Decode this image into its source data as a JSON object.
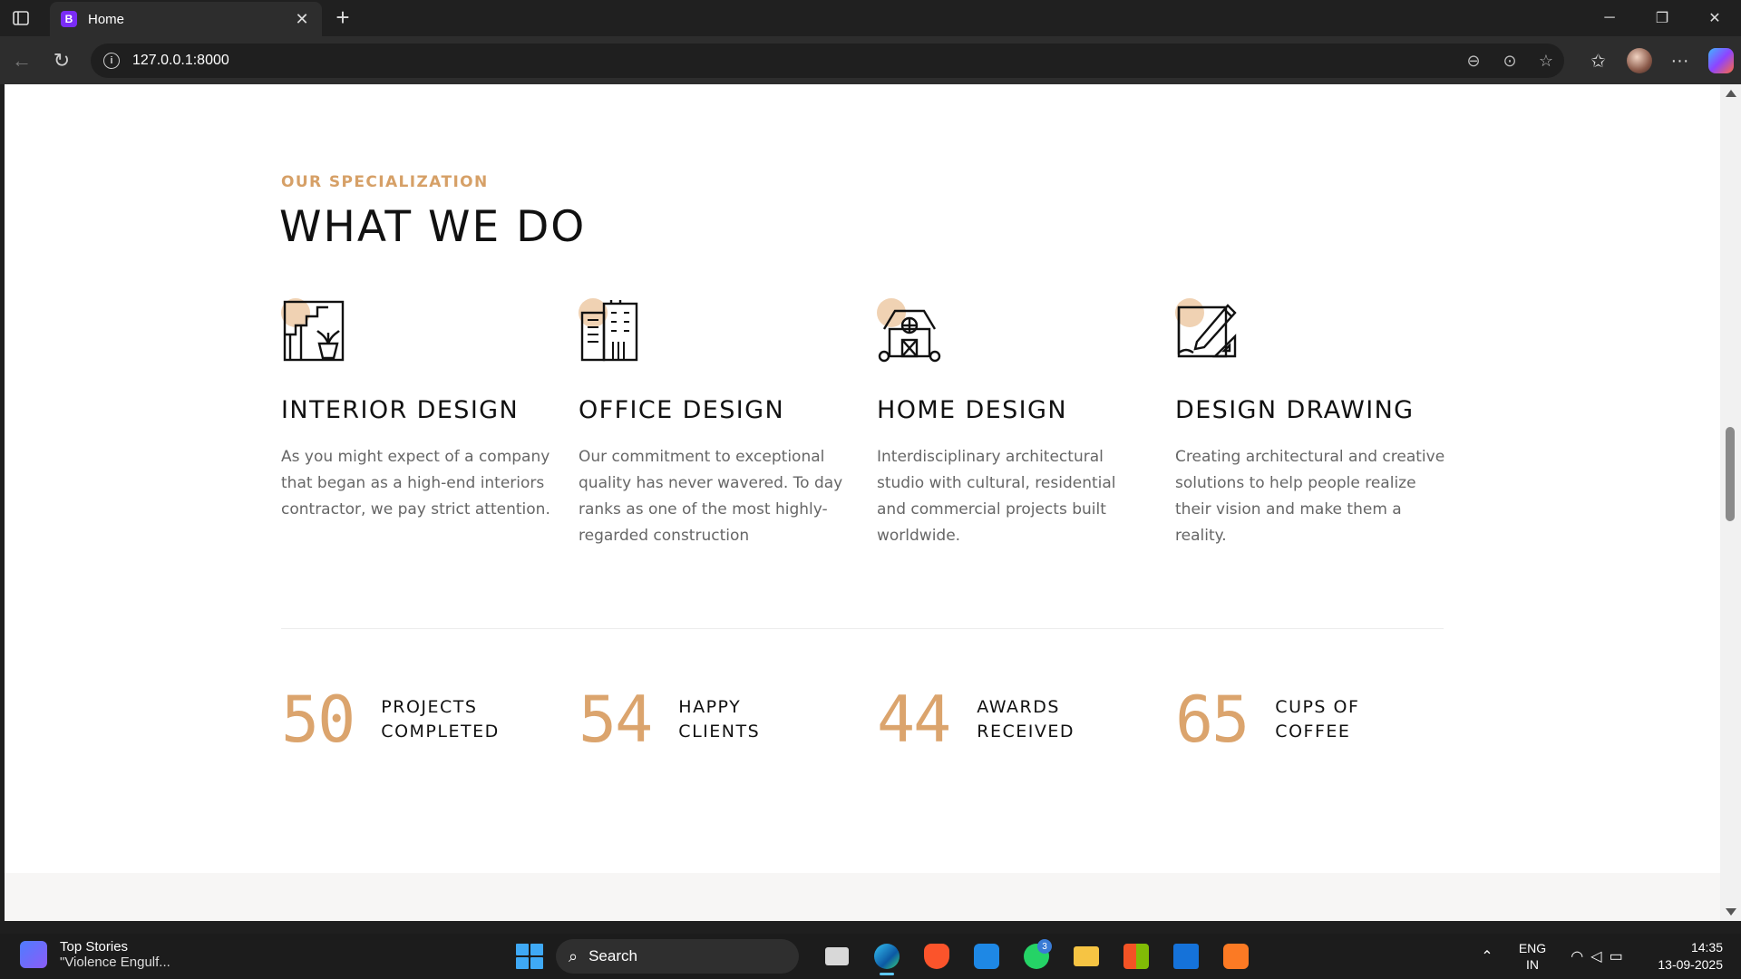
{
  "browser": {
    "tab_title": "Home",
    "tab_favicon_letter": "B",
    "url": "127.0.0.1:8000"
  },
  "page": {
    "eyebrow": "OUR SPECIALIZATION",
    "title": "WHAT WE DO",
    "accent_color": "#d6a067",
    "services": [
      {
        "icon": "staircase-plant-icon",
        "title": "INTERIOR DESIGN",
        "text": "As you might expect of a company that began as a high-end interiors contractor, we pay strict attention."
      },
      {
        "icon": "office-building-icon",
        "title": "OFFICE DESIGN",
        "text": "Our commitment to exceptional quality has never wavered. To day ranks as one of the most highly-regarded construction"
      },
      {
        "icon": "barn-house-icon",
        "title": "HOME DESIGN",
        "text": "Interdisciplinary architectural studio with cultural, residential and commercial projects built worldwide."
      },
      {
        "icon": "blueprint-pencil-icon",
        "title": "DESIGN DRAWING",
        "text": "Creating architectural and creative solutions to help people realize their vision and make them a reality."
      }
    ],
    "stats": [
      {
        "number": "50",
        "label": "PROJECTS COMPLETED"
      },
      {
        "number": "54",
        "label": "HAPPY CLIENTS"
      },
      {
        "number": "44",
        "label": "AWARDS RECEIVED"
      },
      {
        "number": "65",
        "label": "CUPS OF COFFEE"
      }
    ]
  },
  "taskbar": {
    "news_title": "Top Stories",
    "news_subtitle": "\"Violence Engulf...",
    "search_label": "Search",
    "whatsapp_badge": "3",
    "lang_line1": "ENG",
    "lang_line2": "IN",
    "time": "14:35",
    "date": "13-09-2025"
  }
}
